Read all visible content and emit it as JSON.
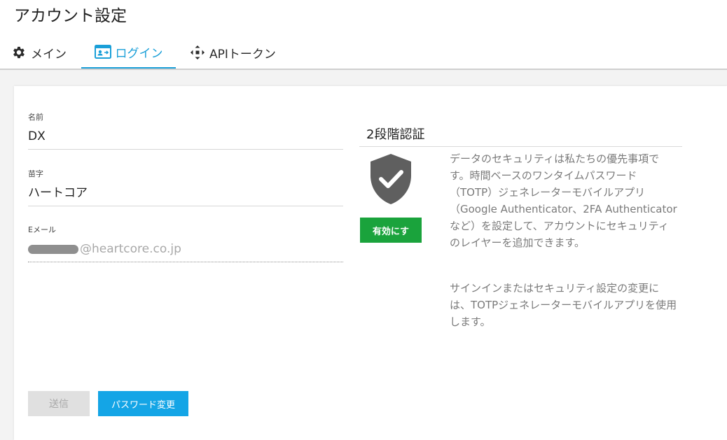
{
  "page": {
    "title": "アカウント設定"
  },
  "tabs": [
    {
      "label": "メイン",
      "icon": "gear-icon"
    },
    {
      "label": "ログイン",
      "icon": "id-card-icon",
      "active": true
    },
    {
      "label": "APIトークン",
      "icon": "move-arrows-icon"
    }
  ],
  "form": {
    "name_label": "名前",
    "name_value": "DX",
    "lastname_label": "苗字",
    "lastname_value": "ハートコア",
    "email_label": "Eメール",
    "email_domain": "@heartcore.co.jp"
  },
  "twofa": {
    "title": "2段階認証",
    "enable_label": "有効にす",
    "description1": "データのセキュリティは私たちの優先事項です。時間ベースのワンタイムパスワード（TOTP）ジェネレーターモバイルアプリ（Google Authenticator、2FA Authenticatorなど）を設定して、アカウントにセキュリティのレイヤーを追加できます。",
    "description2": "サインインまたはセキュリティ設定の変更には、TOTPジェネレーターモバイルアプリを使用します。"
  },
  "buttons": {
    "send_label": "送信",
    "change_password_label": "パスワード変更"
  },
  "colors": {
    "accent": "#1a9fd8",
    "enable_button": "#1aa33c",
    "primary_button": "#14a5e6",
    "shield": "#5f5f5f"
  }
}
